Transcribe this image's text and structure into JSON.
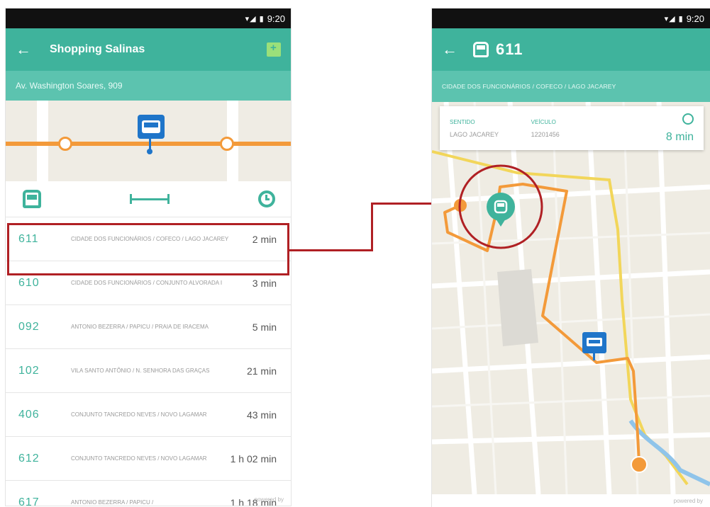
{
  "status": {
    "time": "9:20"
  },
  "left": {
    "title": "Shopping Salinas",
    "address": "Av. Washington Soares, 909",
    "arrivals": [
      {
        "route": "611",
        "destination": "CIDADE DOS FUNCIONÁRIOS / COFECO / LAGO JACAREY",
        "eta": "2 min"
      },
      {
        "route": "610",
        "destination": "CIDADE DOS FUNCIONÁRIOS / CONJUNTO ALVORADA I",
        "eta": "3 min"
      },
      {
        "route": "092",
        "destination": "ANTONIO BEZERRA / PAPICU / PRAIA DE IRACEMA",
        "eta": "5 min"
      },
      {
        "route": "102",
        "destination": "VILA SANTO ANTÔNIO / N. SENHORA DAS GRAÇAS",
        "eta": "21 min"
      },
      {
        "route": "406",
        "destination": "CONJUNTO TANCREDO NEVES / NOVO LAGAMAR",
        "eta": "43 min"
      },
      {
        "route": "612",
        "destination": "CONJUNTO TANCREDO NEVES / NOVO LAGAMAR",
        "eta": "1 h 02 min"
      },
      {
        "route": "617",
        "destination": "ANTONIO BEZERRA / PAPICU /",
        "eta": "1 h 18 min"
      }
    ],
    "footer": "powered by"
  },
  "right": {
    "route": "611",
    "subtitle": "CIDADE DOS FUNCIONÁRIOS / COFECO / LAGO JACAREY",
    "card": {
      "direction_label": "SENTIDO",
      "direction_value": "LAGO JACAREY",
      "vehicle_label": "VEÍCULO",
      "vehicle_value": "12201456",
      "eta": "8 min"
    },
    "footer": "powered by"
  },
  "colors": {
    "primary": "#3fb39c",
    "highlight": "#b02024",
    "route": "#f39a3a",
    "stop": "#1f75c9"
  }
}
